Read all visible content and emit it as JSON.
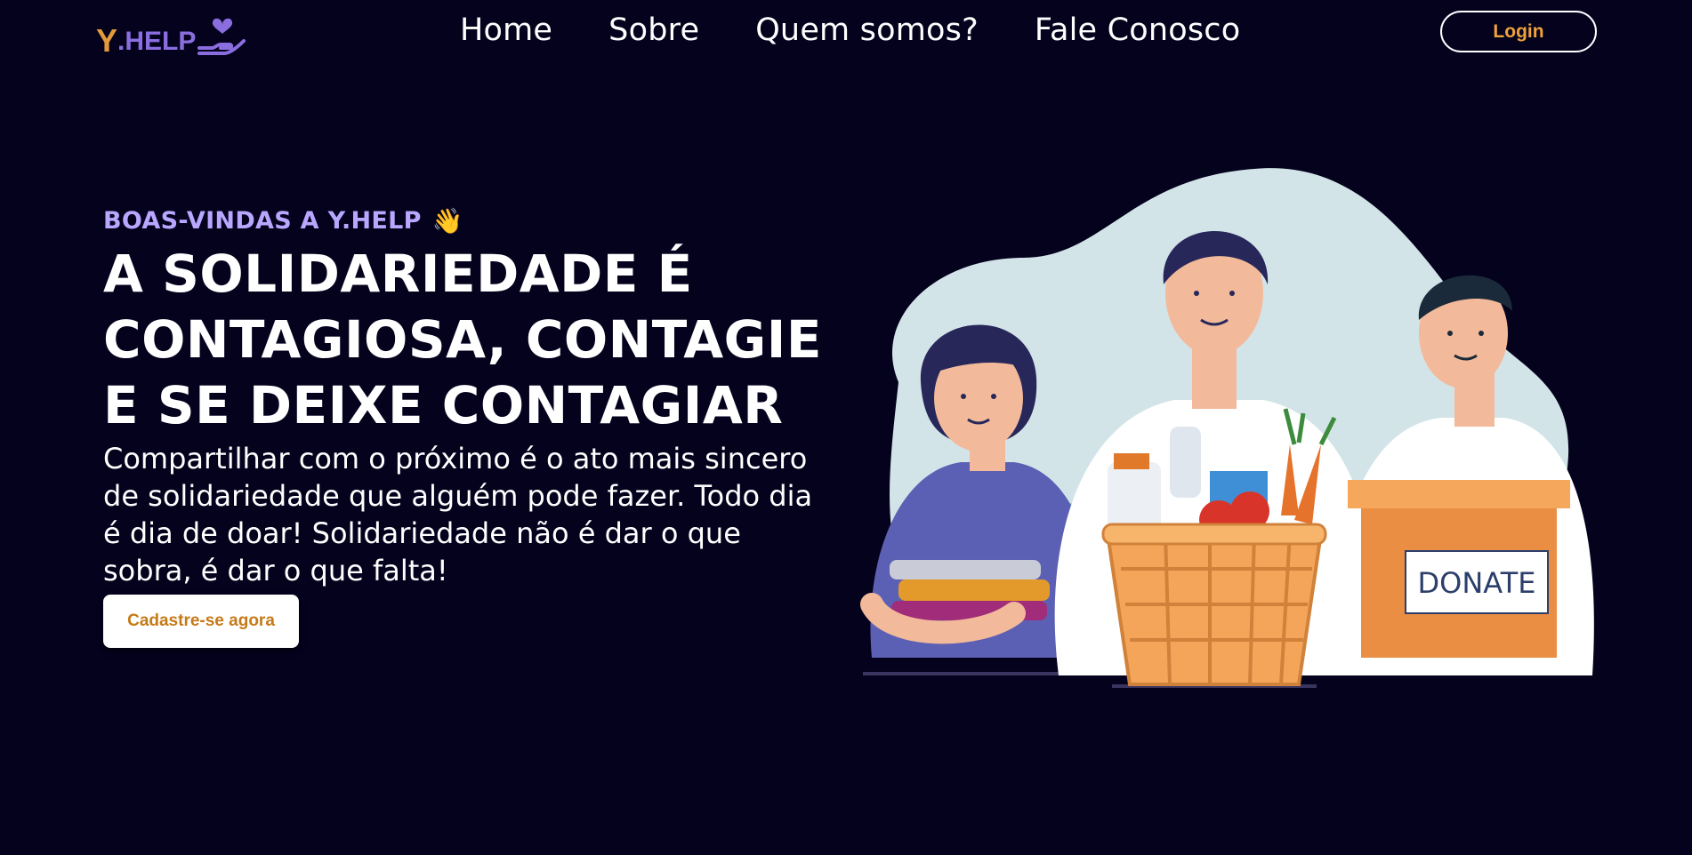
{
  "brand": {
    "logo_y": "Y",
    "logo_rest": ".HELP",
    "colors": {
      "y": "#e39a3b",
      "rest": "#8a6ee0",
      "background": "#04021d",
      "eyebrow": "#b9a7ff",
      "cta_text": "#c57a18"
    },
    "logo_icon": "heart-hand-icon"
  },
  "nav": {
    "links": [
      {
        "label": "Home"
      },
      {
        "label": "Sobre"
      },
      {
        "label": "Quem somos?"
      },
      {
        "label": "Fale Conosco"
      }
    ],
    "login_label": "Login"
  },
  "hero": {
    "eyebrow": "BOAS-VINDAS A Y.HELP",
    "eyebrow_icon": "waving-hand-icon",
    "headline": "A SOLIDARIEDADE É CONTAGIOSA, CONTAGIE E SE DEIXE CONTAGIAR",
    "description": "Compartilhar com o próximo é o ato mais sincero de solidariedade que alguém pode fazer. Todo dia é dia de doar! Solidariedade não é dar o que sobra, é dar o que falta!",
    "cta_label": "Cadastre-se agora"
  },
  "illustration": {
    "box_label": "DONATE"
  }
}
